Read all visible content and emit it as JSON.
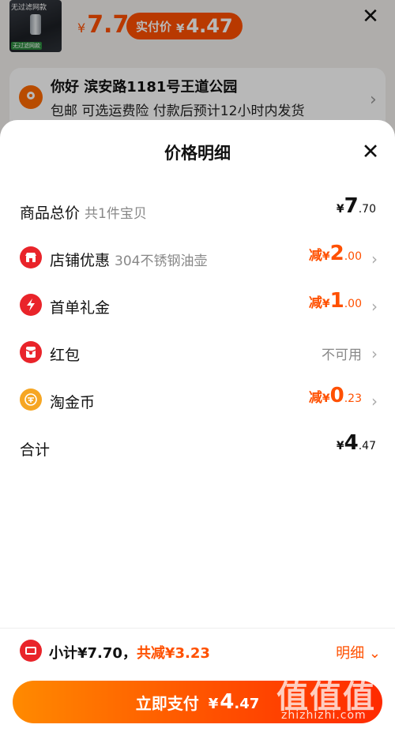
{
  "background": {
    "product_thumb": {
      "tag_top": "无过滤网款",
      "tag_bottom": "无过滤网款"
    },
    "price": {
      "currency": "¥",
      "amount": "7.7"
    },
    "pay_pill": {
      "label": "实付价",
      "currency": "¥",
      "amount": "4.47"
    },
    "address": {
      "name": "你好 滨安路1181号王道公园",
      "desc": "包邮 可选运费险 付款后预计12小时内发货"
    }
  },
  "sheet": {
    "title": "价格明细",
    "rows": [
      {
        "label": "商品总价",
        "sub": "共1件宝贝",
        "prefix": "",
        "currency": "¥",
        "int": "7",
        "dec": ".70",
        "chevron": false
      },
      {
        "label": "店铺优惠",
        "sub": "304不锈钢油壶",
        "prefix": "减",
        "currency": "¥",
        "int": "2",
        "dec": ".00",
        "chevron": true,
        "icon": "shop-icon"
      },
      {
        "label": "首单礼金",
        "sub": "",
        "prefix": "减",
        "currency": "¥",
        "int": "1",
        "dec": ".00",
        "chevron": true,
        "icon": "flash-icon"
      },
      {
        "label": "红包",
        "sub": "",
        "status": "不可用",
        "chevron": true,
        "icon": "red-packet-icon"
      },
      {
        "label": "淘金币",
        "sub": "",
        "prefix": "减",
        "currency": "¥",
        "int": "0",
        "dec": ".23",
        "chevron": true,
        "icon": "coin-icon"
      },
      {
        "label": "合计",
        "sub": "",
        "prefix": "",
        "currency": "¥",
        "int": "4",
        "dec": ".47",
        "chevron": false
      }
    ]
  },
  "footer": {
    "subtotal_label": "小计¥7.70，",
    "discount_label": "共减¥3.23",
    "detail_link": "明细",
    "pay_button": {
      "label": "立即支付",
      "currency": "¥",
      "int": "4",
      "dec": ".47"
    }
  },
  "watermark": {
    "glyphs": "值值值",
    "url": "zhizhizhi.com"
  },
  "colors": {
    "accent": "#ff5000",
    "icon_red": "#e9242a",
    "coin": "#f6a623"
  }
}
